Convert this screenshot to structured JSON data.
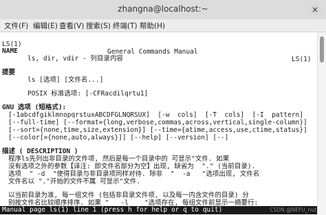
{
  "window": {
    "title": "zhangna@localhost:~",
    "close_symbol": "×"
  },
  "menu": [
    "文件(F)",
    "编辑(E)",
    "查看(V)",
    "搜索(S)",
    "终端(T)",
    "帮助(H)"
  ],
  "man": {
    "header": {
      "left": "LS(1)",
      "center": "General Commands Manual",
      "right": "LS(1)"
    },
    "name_heading": "NAME",
    "name_line": "ls, dir, vdir - 列目录内容",
    "synopsis_heading": "提要",
    "synopsis_line": "ls [选项] [文件名...]",
    "posix_line": "POSIX 标准选项: [-CFRacdilqrtu1]",
    "gnu_heading": "GNU 选项 (短格式):",
    "gnu_lines": [
      "[-1abcdfgiklmnopqrstuxABCDFGLNQRSUX]  [-w  cols]  [-T  cols]  [-I  pattern]",
      "[--full-time] [--format={long,verbose,commas,across,vertical,single-column}]",
      "[--sort={none,time,size,extension}] [--time={atime,access,use,ctime,status}]",
      "[--color[={none,auto,always}]] [--help] [--version] [--]"
    ],
    "desc_heading": "描述 ( DESCRIPTION )",
    "desc_lines": [
      "程序ls先列出非目录的文件项, 然后是每一个目录中的 可显示\"文件. 如果",
      "没有选项之外的参数【译注: 即文件名部分为空】出现, 缺省为  \".\" (当前目录).",
      "选项  \" -d  \"使得目录与非目录项同样对待. 除非  \"  -a   \"选项出现, 文件名",
      "文件名以 \".\"开始的文件不属 可显示\"文件.",
      "",
      "以当前目录为准, 每一组文件 (包括非目录文件项, 以及每一内含文件的目录) 分",
      "别按文件名比较顺序排序. 如果 \"   -l    \"选项存在, 每组文件前显示一摘要行:"
    ],
    "status_line": "Manual page ls(1) line 1 (press h for help or q to quit)"
  },
  "watermark": "CSDN @NEFU_nut"
}
